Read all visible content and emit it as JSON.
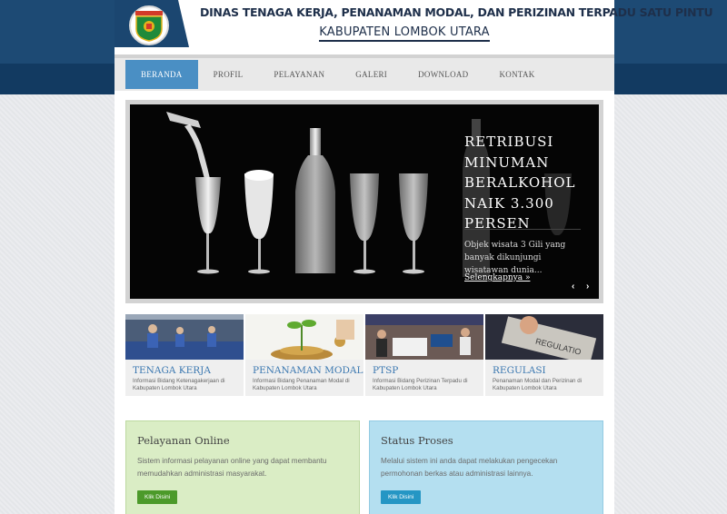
{
  "header": {
    "title": "DINAS TENAGA KERJA, PENANAMAN MODAL, DAN PERIZINAN TERPADU SATU PINTU",
    "subtitle": "KABUPATEN LOMBOK UTARA"
  },
  "nav": {
    "items": [
      {
        "label": "BERANDA",
        "active": true
      },
      {
        "label": "PROFIL"
      },
      {
        "label": "PELAYANAN"
      },
      {
        "label": "GALERI"
      },
      {
        "label": "DOWNLOAD"
      },
      {
        "label": "KONTAK"
      }
    ]
  },
  "slider": {
    "title": "RETRIBUSI MINUMAN BERALKOHOL NAIK 3.300 PERSEN",
    "excerpt": "Objek wisata 3 Gili yang banyak dikunjungi wisatawan dunia...",
    "link": "Selengkapnya »",
    "prev": "‹",
    "next": "›"
  },
  "services": [
    {
      "title": "TENAGA KERJA",
      "desc": "Informasi Bidang Ketenagakerjaan di Kabupaten Lombok Utara"
    },
    {
      "title": "PENANAMAN MODAL",
      "desc": "Informasi Bidang Penanaman Modal di Kabupaten Lombok Utara"
    },
    {
      "title": "PTSP",
      "desc": "Informasi Bidang Perizinan Terpadu di Kabupaten Lombok Utara"
    },
    {
      "title": "REGULASI",
      "desc": "Penanaman Modal dan Perizinan di Kabupaten Lombok Utara"
    }
  ],
  "panels": {
    "online": {
      "title": "Pelayanan Online",
      "text": "Sistem informasi pelayanan online yang dapat membantu memudahkan administrasi masyarakat.",
      "button": "Klik Disini"
    },
    "status": {
      "title": "Status Proses",
      "text": "Melalui sistem ini anda dapat melakukan pengecekan permohonan berkas atau administrasi lainnya.",
      "button": "Klik Disini"
    }
  },
  "colors": {
    "brand_blue": "#1d4a74",
    "nav_active": "#4a8fc4",
    "link_blue": "#3a77b0",
    "panel_green": "#daedc5",
    "panel_blue": "#b4dff0"
  },
  "icons": {
    "logo": "regency-emblem-icon"
  }
}
